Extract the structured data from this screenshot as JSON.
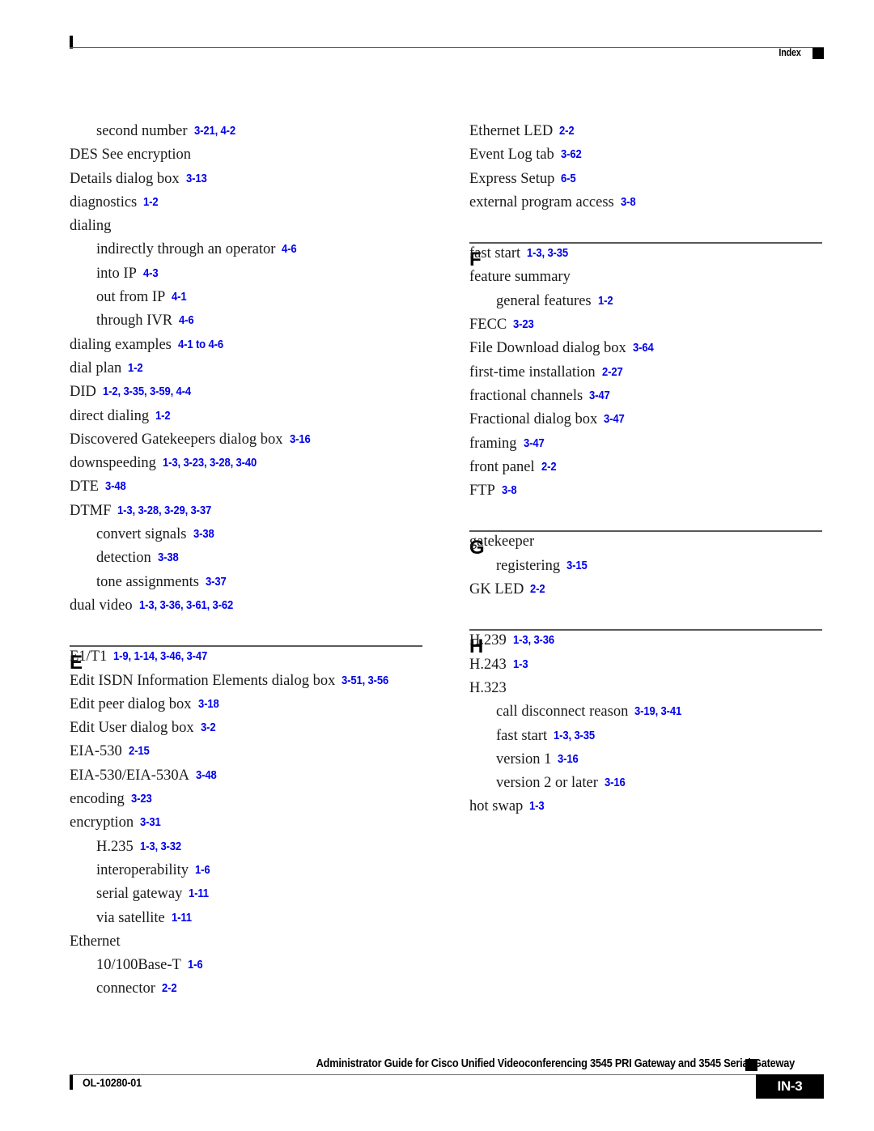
{
  "header": {
    "label": "Index"
  },
  "footer": {
    "doc_title": "Administrator Guide for Cisco Unified Videoconferencing 3545 PRI Gateway and 3545 Serial Gateway",
    "doc_id": "OL-10280-01",
    "page_number": "IN-3"
  },
  "colors": {
    "page_reference": "#0000EE",
    "text": "#1A1A1A",
    "rule": "#5A5A5A"
  },
  "columns": {
    "left": [
      {
        "kind": "entry",
        "level": 1,
        "term": "second number",
        "pages": "3-21, 4-2"
      },
      {
        "kind": "entry",
        "level": 0,
        "term": "DES See encryption",
        "pages": ""
      },
      {
        "kind": "entry",
        "level": 0,
        "term": "Details dialog box",
        "pages": "3-13"
      },
      {
        "kind": "entry",
        "level": 0,
        "term": "diagnostics",
        "pages": "1-2"
      },
      {
        "kind": "entry",
        "level": 0,
        "term": "dialing",
        "pages": ""
      },
      {
        "kind": "entry",
        "level": 1,
        "term": "indirectly through an operator",
        "pages": "4-6"
      },
      {
        "kind": "entry",
        "level": 1,
        "term": "into IP",
        "pages": "4-3"
      },
      {
        "kind": "entry",
        "level": 1,
        "term": "out from IP",
        "pages": "4-1"
      },
      {
        "kind": "entry",
        "level": 1,
        "term": "through IVR",
        "pages": "4-6"
      },
      {
        "kind": "entry",
        "level": 0,
        "term": "dialing examples",
        "pages": "4-1 to 4-6"
      },
      {
        "kind": "entry",
        "level": 0,
        "term": "dial plan",
        "pages": "1-2"
      },
      {
        "kind": "entry",
        "level": 0,
        "term": "DID",
        "pages": "1-2, 3-35, 3-59, 4-4"
      },
      {
        "kind": "entry",
        "level": 0,
        "term": "direct dialing",
        "pages": "1-2"
      },
      {
        "kind": "entry",
        "level": 0,
        "term": "Discovered Gatekeepers dialog box",
        "pages": "3-16"
      },
      {
        "kind": "entry",
        "level": 0,
        "term": "downspeeding",
        "pages": "1-3, 3-23, 3-28, 3-40"
      },
      {
        "kind": "entry",
        "level": 0,
        "term": "DTE",
        "pages": "3-48"
      },
      {
        "kind": "entry",
        "level": 0,
        "term": "DTMF",
        "pages": "1-3, 3-28, 3-29, 3-37"
      },
      {
        "kind": "entry",
        "level": 1,
        "term": "convert signals",
        "pages": "3-38"
      },
      {
        "kind": "entry",
        "level": 1,
        "term": "detection",
        "pages": "3-38"
      },
      {
        "kind": "entry",
        "level": 1,
        "term": "tone assignments",
        "pages": "3-37"
      },
      {
        "kind": "entry",
        "level": 0,
        "term": "dual video",
        "pages": "1-3, 3-36, 3-61, 3-62"
      },
      {
        "kind": "section",
        "letter": "E"
      },
      {
        "kind": "entry",
        "level": 0,
        "term": "E1/T1",
        "pages": "1-9, 1-14, 3-46, 3-47"
      },
      {
        "kind": "entry",
        "level": 0,
        "term": "Edit ISDN Information Elements dialog box",
        "pages": "3-51, 3-56"
      },
      {
        "kind": "entry",
        "level": 0,
        "term": "Edit peer dialog box",
        "pages": "3-18"
      },
      {
        "kind": "entry",
        "level": 0,
        "term": "Edit User dialog box",
        "pages": "3-2"
      },
      {
        "kind": "entry",
        "level": 0,
        "term": "EIA-530",
        "pages": "2-15"
      },
      {
        "kind": "entry",
        "level": 0,
        "term": "EIA-530/EIA-530A",
        "pages": "3-48"
      },
      {
        "kind": "entry",
        "level": 0,
        "term": "encoding",
        "pages": "3-23"
      },
      {
        "kind": "entry",
        "level": 0,
        "term": "encryption",
        "pages": "3-31"
      },
      {
        "kind": "entry",
        "level": 1,
        "term": "H.235",
        "pages": "1-3, 3-32"
      },
      {
        "kind": "entry",
        "level": 1,
        "term": "interoperability",
        "pages": "1-6"
      },
      {
        "kind": "entry",
        "level": 1,
        "term": "serial gateway",
        "pages": "1-11"
      },
      {
        "kind": "entry",
        "level": 1,
        "term": "via satellite",
        "pages": "1-11"
      },
      {
        "kind": "entry",
        "level": 0,
        "term": "Ethernet",
        "pages": ""
      },
      {
        "kind": "entry",
        "level": 1,
        "term": "10/100Base-T",
        "pages": "1-6"
      },
      {
        "kind": "entry",
        "level": 1,
        "term": "connector",
        "pages": "2-2"
      }
    ],
    "right": [
      {
        "kind": "entry",
        "level": 0,
        "term": "Ethernet LED",
        "pages": "2-2"
      },
      {
        "kind": "entry",
        "level": 0,
        "term": "Event Log tab",
        "pages": "3-62"
      },
      {
        "kind": "entry",
        "level": 0,
        "term": "Express Setup",
        "pages": "6-5"
      },
      {
        "kind": "entry",
        "level": 0,
        "term": "external program access",
        "pages": "3-8"
      },
      {
        "kind": "section",
        "letter": "F"
      },
      {
        "kind": "entry",
        "level": 0,
        "term": "fast start",
        "pages": "1-3, 3-35"
      },
      {
        "kind": "entry",
        "level": 0,
        "term": "feature summary",
        "pages": ""
      },
      {
        "kind": "entry",
        "level": 1,
        "term": "general features",
        "pages": "1-2"
      },
      {
        "kind": "entry",
        "level": 0,
        "term": "FECC",
        "pages": "3-23"
      },
      {
        "kind": "entry",
        "level": 0,
        "term": "File Download dialog box",
        "pages": "3-64"
      },
      {
        "kind": "entry",
        "level": 0,
        "term": "first-time installation",
        "pages": "2-27"
      },
      {
        "kind": "entry",
        "level": 0,
        "term": "fractional channels",
        "pages": "3-47"
      },
      {
        "kind": "entry",
        "level": 0,
        "term": "Fractional dialog box",
        "pages": "3-47"
      },
      {
        "kind": "entry",
        "level": 0,
        "term": "framing",
        "pages": "3-47"
      },
      {
        "kind": "entry",
        "level": 0,
        "term": "front panel",
        "pages": "2-2"
      },
      {
        "kind": "entry",
        "level": 0,
        "term": "FTP",
        "pages": "3-8"
      },
      {
        "kind": "section",
        "letter": "G"
      },
      {
        "kind": "entry",
        "level": 0,
        "term": "gatekeeper",
        "pages": ""
      },
      {
        "kind": "entry",
        "level": 1,
        "term": "registering",
        "pages": "3-15"
      },
      {
        "kind": "entry",
        "level": 0,
        "term": "GK LED",
        "pages": "2-2"
      },
      {
        "kind": "section",
        "letter": "H"
      },
      {
        "kind": "entry",
        "level": 0,
        "term": "H.239",
        "pages": "1-3, 3-36"
      },
      {
        "kind": "entry",
        "level": 0,
        "term": "H.243",
        "pages": "1-3"
      },
      {
        "kind": "entry",
        "level": 0,
        "term": "H.323",
        "pages": ""
      },
      {
        "kind": "entry",
        "level": 1,
        "term": "call disconnect reason",
        "pages": "3-19, 3-41"
      },
      {
        "kind": "entry",
        "level": 1,
        "term": "fast start",
        "pages": "1-3, 3-35"
      },
      {
        "kind": "entry",
        "level": 1,
        "term": "version 1",
        "pages": "3-16"
      },
      {
        "kind": "entry",
        "level": 1,
        "term": "version 2 or later",
        "pages": "3-16"
      },
      {
        "kind": "entry",
        "level": 0,
        "term": "hot swap",
        "pages": "1-3"
      }
    ]
  }
}
